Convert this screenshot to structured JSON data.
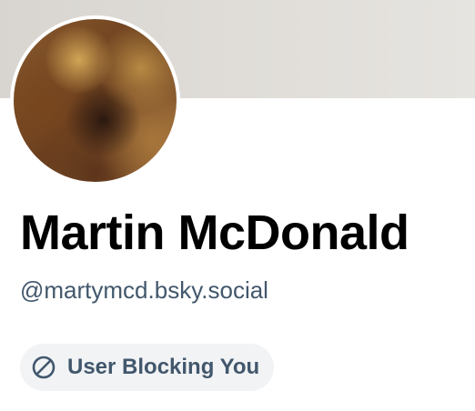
{
  "profile": {
    "display_name": "Martin McDonald",
    "handle": "@martymcd.bsky.social",
    "banner_color": "#dfdcd7",
    "avatar_alt": "blurred profile photo",
    "status_badge": {
      "label": "User Blocking You",
      "icon": "block-icon",
      "text_color": "#42576c",
      "background": "#f1f3f5"
    }
  }
}
